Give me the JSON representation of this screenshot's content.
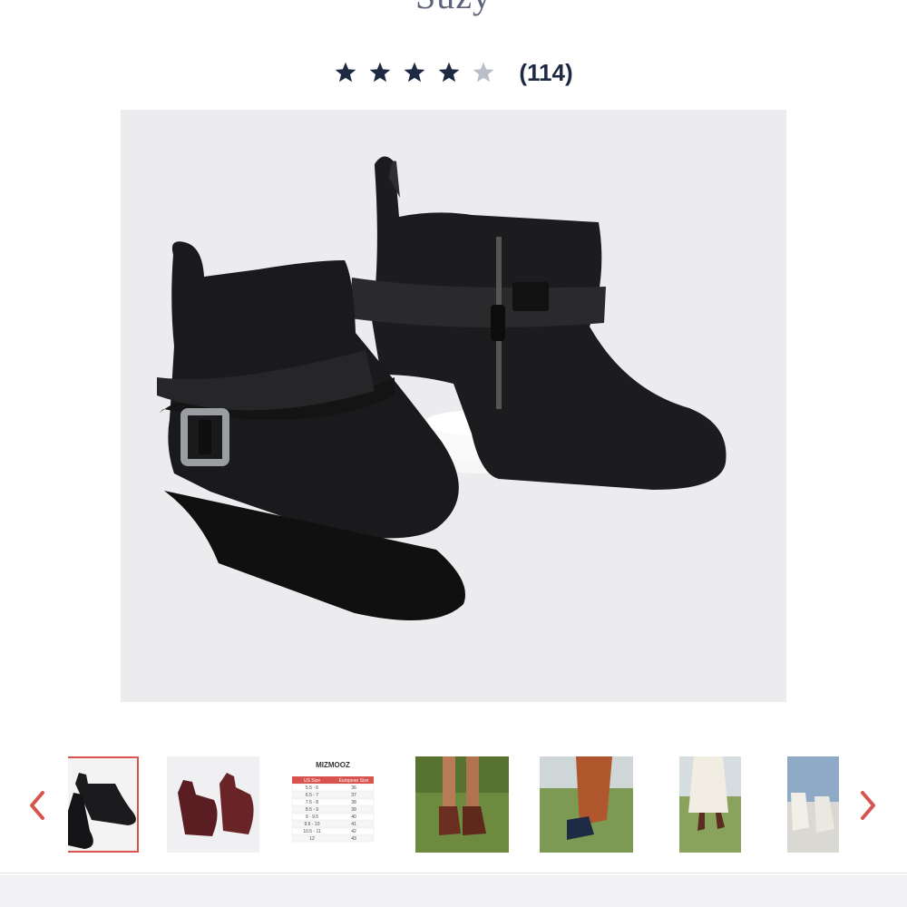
{
  "product": {
    "title": "Suzy",
    "rating_stars": 4,
    "rating_max": 5,
    "review_count": "(114)"
  },
  "colors": {
    "star_filled": "#1e2a44",
    "star_empty": "#b9bec8",
    "accent_red": "#d9534f",
    "text_dark": "#1e2a44"
  },
  "gallery": {
    "prev_icon": "chevron-left-icon",
    "next_icon": "chevron-right-icon",
    "thumbnails": [
      {
        "name": "black-boots",
        "active": true
      },
      {
        "name": "burgundy-boots",
        "active": false
      },
      {
        "name": "size-chart",
        "active": false
      },
      {
        "name": "brown-boots-on-model",
        "active": false
      },
      {
        "name": "navy-boot-on-model",
        "active": false
      },
      {
        "name": "model-in-field",
        "active": false
      },
      {
        "name": "white-boots-on-model",
        "active": false
      }
    ]
  },
  "size_chart": {
    "brand": "MIZMOOZ",
    "headers": [
      "US Size",
      "European Size"
    ],
    "rows": [
      [
        "5.5 - 6",
        "36"
      ],
      [
        "6.5 - 7",
        "37"
      ],
      [
        "7.5 - 8",
        "38"
      ],
      [
        "8.5 - 9",
        "39"
      ],
      [
        "9 - 9.5",
        "40"
      ],
      [
        "9.5 - 10",
        "41"
      ],
      [
        "10.5 - 11",
        "42"
      ],
      [
        "12",
        "43"
      ]
    ]
  }
}
